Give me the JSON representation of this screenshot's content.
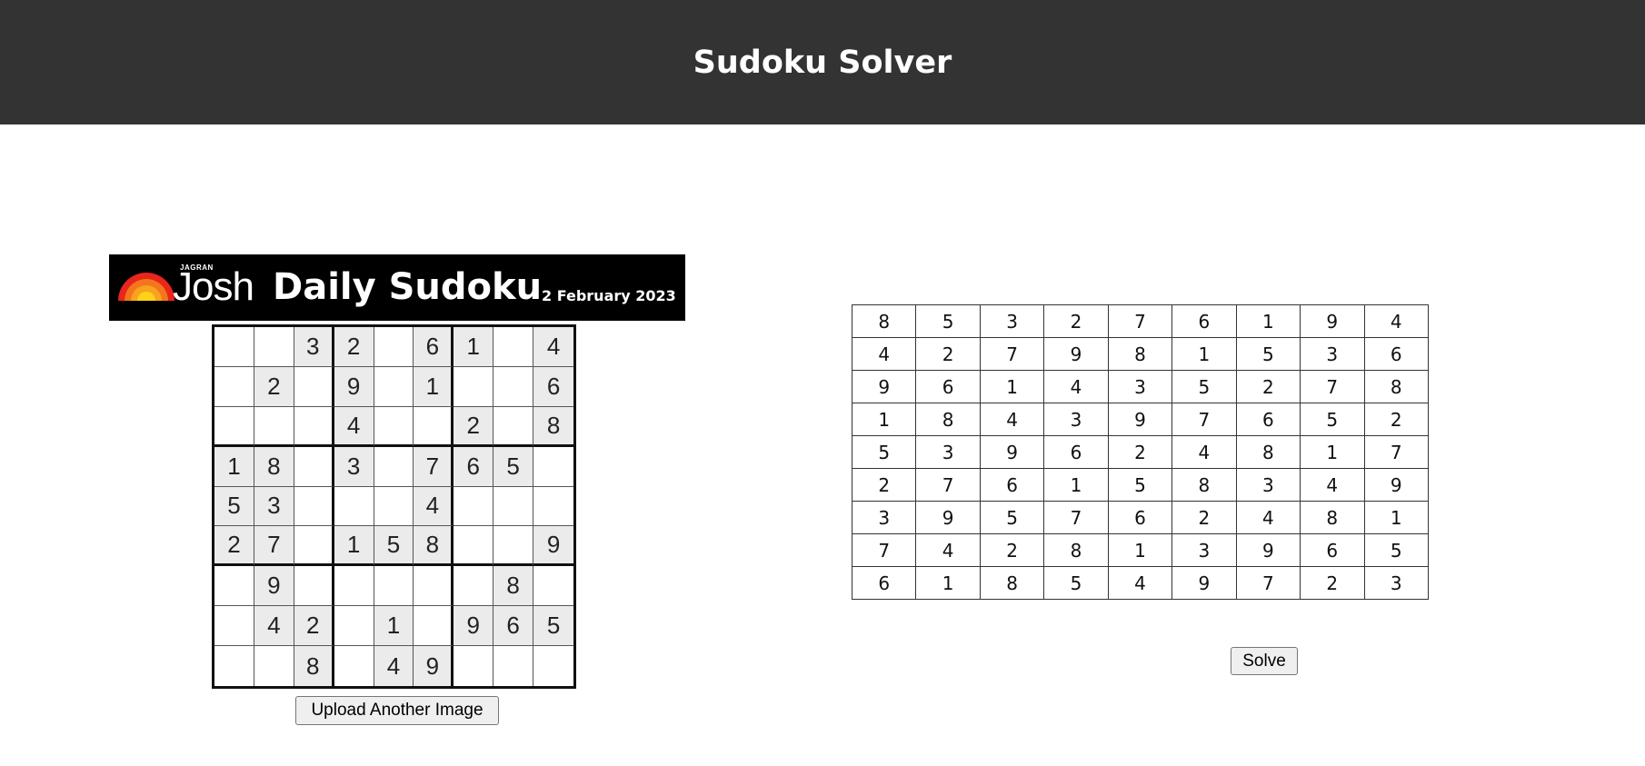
{
  "header": {
    "title": "Sudoku Solver"
  },
  "uploaded_image": {
    "brand_small": "JAGRAN",
    "brand_big": "Josh",
    "title": "Daily Sudoku",
    "date": "2 February 2023",
    "puzzle": [
      [
        "",
        "",
        "3",
        "2",
        "",
        "6",
        "1",
        "",
        "4"
      ],
      [
        "",
        "2",
        "",
        "9",
        "",
        "1",
        "",
        "",
        "6"
      ],
      [
        "",
        "",
        "",
        "4",
        "",
        "",
        "2",
        "",
        "8"
      ],
      [
        "1",
        "8",
        "",
        "3",
        "",
        "7",
        "6",
        "5",
        ""
      ],
      [
        "5",
        "3",
        "",
        "",
        "",
        "4",
        "",
        "",
        ""
      ],
      [
        "2",
        "7",
        "",
        "1",
        "5",
        "8",
        "",
        "",
        "9"
      ],
      [
        "",
        "9",
        "",
        "",
        "",
        "",
        "",
        "8",
        ""
      ],
      [
        "",
        "4",
        "2",
        "",
        "1",
        "",
        "9",
        "6",
        "5"
      ],
      [
        "",
        "",
        "8",
        "",
        "4",
        "9",
        "",
        "",
        ""
      ]
    ],
    "shaded_cells": [
      [
        0,
        2
      ],
      [
        0,
        3
      ],
      [
        0,
        5
      ],
      [
        0,
        6
      ],
      [
        0,
        8
      ],
      [
        1,
        1
      ],
      [
        1,
        3
      ],
      [
        1,
        5
      ],
      [
        1,
        8
      ],
      [
        2,
        3
      ],
      [
        2,
        6
      ],
      [
        2,
        8
      ],
      [
        3,
        0
      ],
      [
        3,
        1
      ],
      [
        3,
        3
      ],
      [
        3,
        5
      ],
      [
        3,
        6
      ],
      [
        3,
        7
      ],
      [
        4,
        0
      ],
      [
        4,
        1
      ],
      [
        4,
        5
      ],
      [
        5,
        0
      ],
      [
        5,
        1
      ],
      [
        5,
        3
      ],
      [
        5,
        4
      ],
      [
        5,
        5
      ],
      [
        5,
        8
      ],
      [
        6,
        1
      ],
      [
        6,
        7
      ],
      [
        7,
        1
      ],
      [
        7,
        2
      ],
      [
        7,
        4
      ],
      [
        7,
        6
      ],
      [
        7,
        7
      ],
      [
        7,
        8
      ],
      [
        8,
        2
      ],
      [
        8,
        4
      ],
      [
        8,
        5
      ]
    ]
  },
  "buttons": {
    "upload_label": "Upload Another Image",
    "solve_label": "Solve"
  },
  "solution": [
    [
      "8",
      "5",
      "3",
      "2",
      "7",
      "6",
      "1",
      "9",
      "4"
    ],
    [
      "4",
      "2",
      "7",
      "9",
      "8",
      "1",
      "5",
      "3",
      "6"
    ],
    [
      "9",
      "6",
      "1",
      "4",
      "3",
      "5",
      "2",
      "7",
      "8"
    ],
    [
      "1",
      "8",
      "4",
      "3",
      "9",
      "7",
      "6",
      "5",
      "2"
    ],
    [
      "5",
      "3",
      "9",
      "6",
      "2",
      "4",
      "8",
      "1",
      "7"
    ],
    [
      "2",
      "7",
      "6",
      "1",
      "5",
      "8",
      "3",
      "4",
      "9"
    ],
    [
      "3",
      "9",
      "5",
      "7",
      "6",
      "2",
      "4",
      "8",
      "1"
    ],
    [
      "7",
      "4",
      "2",
      "8",
      "1",
      "3",
      "9",
      "6",
      "5"
    ],
    [
      "6",
      "1",
      "8",
      "5",
      "4",
      "9",
      "7",
      "2",
      "3"
    ]
  ]
}
